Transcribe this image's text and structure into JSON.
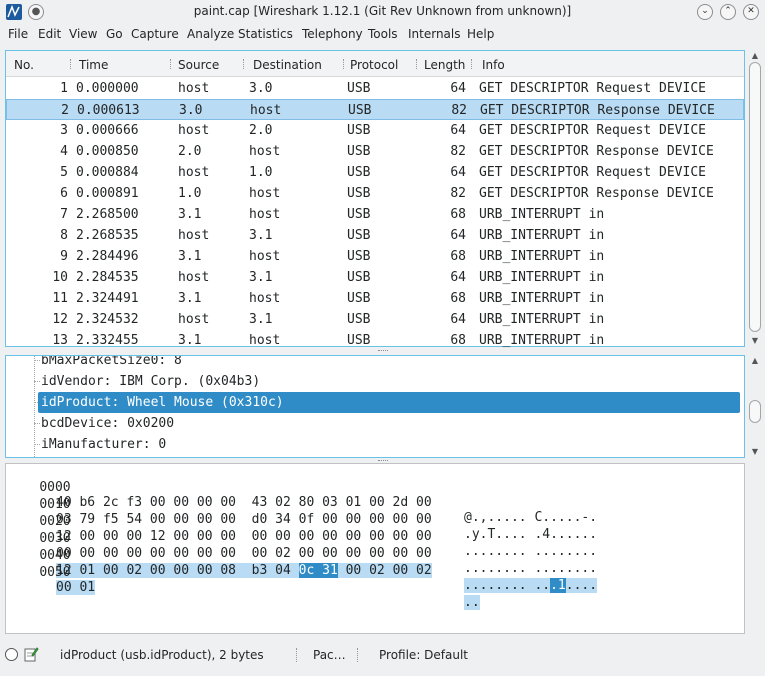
{
  "window": {
    "title": "paint.cap  [Wireshark 1.12.1  (Git Rev Unknown from unknown)]",
    "pin_glyph": "●",
    "min_glyph": "⌄",
    "max_glyph": "⌃",
    "close_glyph": "✕"
  },
  "menu": [
    "File",
    "Edit",
    "View",
    "Go",
    "Capture",
    "Analyze",
    "Statistics",
    "Telephony",
    "Tools",
    "Internals",
    "Help"
  ],
  "packet_list": {
    "columns": [
      "No.",
      "Time",
      "Source",
      "Destination",
      "Protocol",
      "Length",
      "Info"
    ],
    "rows": [
      {
        "no": "1",
        "time": "0.000000",
        "src": "host",
        "dst": "3.0",
        "proto": "USB",
        "len": "64",
        "info": "GET DESCRIPTOR Request DEVICE"
      },
      {
        "no": "2",
        "time": "0.000613",
        "src": "3.0",
        "dst": "host",
        "proto": "USB",
        "len": "82",
        "info": "GET DESCRIPTOR Response DEVICE"
      },
      {
        "no": "3",
        "time": "0.000666",
        "src": "host",
        "dst": "2.0",
        "proto": "USB",
        "len": "64",
        "info": "GET DESCRIPTOR Request DEVICE"
      },
      {
        "no": "4",
        "time": "0.000850",
        "src": "2.0",
        "dst": "host",
        "proto": "USB",
        "len": "82",
        "info": "GET DESCRIPTOR Response DEVICE"
      },
      {
        "no": "5",
        "time": "0.000884",
        "src": "host",
        "dst": "1.0",
        "proto": "USB",
        "len": "64",
        "info": "GET DESCRIPTOR Request DEVICE"
      },
      {
        "no": "6",
        "time": "0.000891",
        "src": "1.0",
        "dst": "host",
        "proto": "USB",
        "len": "82",
        "info": "GET DESCRIPTOR Response DEVICE"
      },
      {
        "no": "7",
        "time": "2.268500",
        "src": "3.1",
        "dst": "host",
        "proto": "USB",
        "len": "68",
        "info": "URB_INTERRUPT in"
      },
      {
        "no": "8",
        "time": "2.268535",
        "src": "host",
        "dst": "3.1",
        "proto": "USB",
        "len": "64",
        "info": "URB_INTERRUPT in"
      },
      {
        "no": "9",
        "time": "2.284496",
        "src": "3.1",
        "dst": "host",
        "proto": "USB",
        "len": "68",
        "info": "URB_INTERRUPT in"
      },
      {
        "no": "10",
        "time": "2.284535",
        "src": "host",
        "dst": "3.1",
        "proto": "USB",
        "len": "64",
        "info": "URB_INTERRUPT in"
      },
      {
        "no": "11",
        "time": "2.324491",
        "src": "3.1",
        "dst": "host",
        "proto": "USB",
        "len": "68",
        "info": "URB_INTERRUPT in"
      },
      {
        "no": "12",
        "time": "2.324532",
        "src": "host",
        "dst": "3.1",
        "proto": "USB",
        "len": "64",
        "info": "URB_INTERRUPT in"
      },
      {
        "no": "13",
        "time": "2.332455",
        "src": "3.1",
        "dst": "host",
        "proto": "USB",
        "len": "68",
        "info": "URB_INTERRUPT in"
      }
    ],
    "selected_no": "2",
    "scroll_up": "▲",
    "scroll_down": "▼"
  },
  "details": {
    "rows": [
      "bMaxPacketSize0: 8",
      "idVendor: IBM Corp. (0x04b3)",
      "idProduct: Wheel Mouse (0x310c)",
      "bcdDevice: 0x0200",
      "iManufacturer: 0"
    ],
    "selected_index": 2
  },
  "bytes": {
    "rows": [
      {
        "offset": "0000",
        "hex": "40 b6 2c f3 00 00 00 00  43 02 80 03 01 00 2d 00",
        "ascii": "@.,..... C.....-."
      },
      {
        "offset": "0010",
        "hex": "03 79 f5 54 00 00 00 00  d0 34 0f 00 00 00 00 00",
        "ascii": ".y.T.... .4......"
      },
      {
        "offset": "0020",
        "hex": "12 00 00 00 12 00 00 00  00 00 00 00 00 00 00 00",
        "ascii": "........ ........"
      },
      {
        "offset": "0030",
        "hex": "00 00 00 00 00 00 00 00  00 02 00 00 00 00 00 00",
        "ascii": "........ ........"
      },
      {
        "offset": "0040",
        "hex_a": "12 01 00 02 00 00 00 08  b3 04 ",
        "hex_b": "0c 31",
        "hex_c": " 00 02 00 02",
        "ascii_a": "........ ..",
        "ascii_b": ".1",
        "ascii_c": "...."
      },
      {
        "offset": "0050",
        "hex": "00 01",
        "ascii": ".."
      }
    ]
  },
  "status": {
    "field": "idProduct (usb.idProduct), 2 bytes",
    "packets": "Pac…",
    "profile": "Profile: Default"
  }
}
